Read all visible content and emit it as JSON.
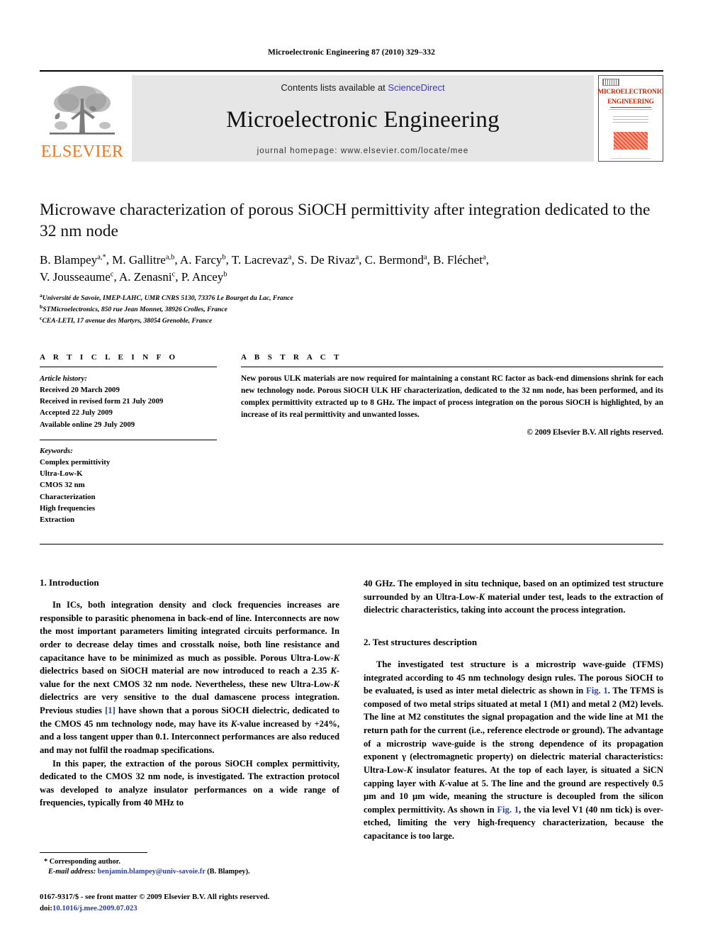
{
  "running_head": "Microelectronic Engineering 87 (2010) 329–332",
  "masthead": {
    "publisher_name": "ELSEVIER",
    "contents_prefix": "Contents lists available at ",
    "contents_link": "ScienceDirect",
    "journal_title": "Microelectronic Engineering",
    "homepage": "journal homepage: www.elsevier.com/locate/mee",
    "cover_title_line1": "MICROELECTRONIC",
    "cover_title_line2": "ENGINEERING",
    "accent_orange": "#E87722",
    "accent_link_blue": "#3a3ab0",
    "cover_red": "#cc2200"
  },
  "article": {
    "title": "Microwave characterization of porous SiOCH permittivity after integration dedicated to the 32 nm node",
    "authors_line1": "B. Blampey a,*, M. Gallitre a,b, A. Farcy b, T. Lacrevaz a, S. De Rivaz a, C. Bermond a, B. Fléchet a,",
    "authors_line2": "V. Jousseaume c, A. Zenasni c, P. Ancey b",
    "affiliations": [
      "Université de Savoie, IMEP-LAHC, UMR CNRS 5130, 73376 Le Bourget du Lac, France",
      "STMicroelectronics, 850 rue Jean Monnet, 38926 Crolles, France",
      "CEA-LETI, 17 avenue des Martyrs, 38054 Grenoble, France"
    ],
    "affiliation_marks": [
      "a",
      "b",
      "c"
    ]
  },
  "info": {
    "heading": "A R T I C L E    I N F O",
    "history_title": "Article history:",
    "history": [
      "Received 20 March 2009",
      "Received in revised form 21 July 2009",
      "Accepted 22 July 2009",
      "Available online 29 July 2009"
    ],
    "keywords_title": "Keywords:",
    "keywords": [
      "Complex permittivity",
      "Ultra-Low-K",
      "CMOS 32 nm",
      "Characterization",
      "High frequencies",
      "Extraction"
    ]
  },
  "abstract": {
    "heading": "A B S T R A C T",
    "text": "New porous ULK materials are now required for maintaining a constant RC factor as back-end dimensions shrink for each new technology node. Porous SiOCH ULK HF characterization, dedicated to the 32 nm node, has been performed, and its complex permittivity extracted up to 8 GHz. The impact of process integration on the porous SiOCH is highlighted, by an increase of its real permittivity and unwanted losses.",
    "copyright": "© 2009 Elsevier B.V. All rights reserved."
  },
  "sections": {
    "intro_heading": "1. Introduction",
    "intro_p1_a": "In ICs, both integration density and clock frequencies increases are responsible to parasitic phenomena in back-end of line. Interconnects are now the most important parameters limiting integrated circuits performance. In order to decrease delay times and crosstalk noise, both line resistance and capacitance have to be minimized as much as possible. Porous Ultra-Low-",
    "intro_p1_k1": "K",
    "intro_p1_b": " dielectrics based on SiOCH material are now introduced to reach a 2.35 ",
    "intro_p1_k2": "K",
    "intro_p1_c": "-value for the next CMOS 32 nm node. Nevertheless, these new Ultra-Low-",
    "intro_p1_k3": "K",
    "intro_p1_d": " dielectrics are very sensitive to the dual damascene process integration. Previous studies ",
    "intro_p1_ref": "[1]",
    "intro_p1_e": " have shown that a porous SiOCH dielectric, dedicated to the CMOS 45 nm technology node, may have its ",
    "intro_p1_k4": "K",
    "intro_p1_f": "-value increased by +24%, and a loss tangent upper than 0.1. Interconnect performances are also reduced and may not fulfil the roadmap specifications.",
    "intro_p2": "In this paper, the extraction of the porous SiOCH complex permittivity, dedicated to the CMOS 32 nm node, is investigated. The extraction protocol was developed to analyze insulator performances on a wide range of frequencies, typically from 40 MHz to",
    "right_p1_a": "40 GHz. The employed in situ technique, based on an optimized test structure surrounded by an Ultra-Low-",
    "right_p1_k": "K",
    "right_p1_b": " material under test, leads to the extraction of dielectric characteristics, taking into account the process integration.",
    "test_heading": "2. Test structures description",
    "test_p1_a": "The investigated test structure is a microstrip wave-guide (TFMS) integrated according to 45 nm technology design rules. The porous SiOCH to be evaluated, is used as inter metal dielectric as shown in ",
    "test_p1_fig1": "Fig. 1",
    "test_p1_b": ". The TFMS is composed of two metal strips situated at metal 1 (M1) and metal 2 (M2) levels. The line at M2 constitutes the signal propagation and the wide line at M1 the return path for the current (i.e., reference electrode or ground). The advantage of a microstrip wave-guide is the strong dependence of its propagation exponent γ (electromagnetic property) on dielectric material characteristics: Ultra-Low-",
    "test_p1_k1": "K",
    "test_p1_c": " insulator features. At the top of each layer, is situated a SiCN capping layer with ",
    "test_p1_k2": "K",
    "test_p1_d": "-value at 5. The line and the ground are respectively 0.5 µm and 10 µm wide, meaning the structure is decoupled from the silicon complex permittivity. As shown in ",
    "test_p1_fig2": "Fig. 1",
    "test_p1_e": ", the via level V1 (40 nm tick) is over-etched, limiting the very high-frequency characterization, because the capacitance is too large."
  },
  "footer": {
    "corresponding_marker": "*",
    "corresponding_label": "Corresponding author.",
    "email_label": "E-mail address:",
    "email": "benjamin.blampey@univ-savoie.fr",
    "email_suffix": "(B. Blampey).",
    "issn_line": "0167-9317/$ - see front matter © 2009 Elsevier B.V. All rights reserved.",
    "doi_prefix": "doi:",
    "doi": "10.1016/j.mee.2009.07.023"
  }
}
